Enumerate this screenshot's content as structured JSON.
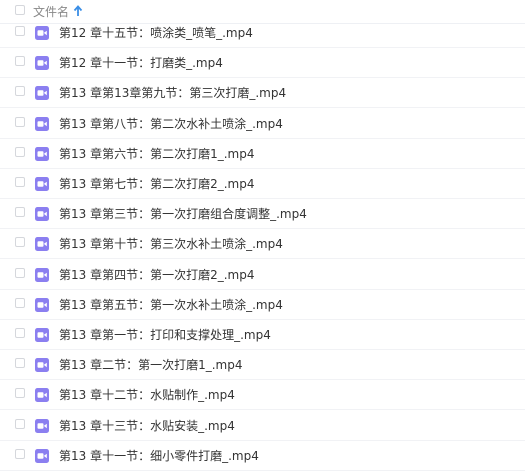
{
  "header": {
    "column_label": "文件名",
    "sort_icon": "sort-ascending-arrow-icon",
    "sort_color": "#3a8ee6"
  },
  "file_icon": "video-file-icon",
  "file_icon_color": "#8b7ff0",
  "files": [
    "第12 章十五节：喷涂类_喷笔_.mp4",
    "第12 章十一节：打磨类_.mp4",
    "第13 章第13章第九节：第三次打磨_.mp4",
    "第13 章第八节：第二次水补土喷涂_.mp4",
    "第13 章第六节：第二次打磨1_.mp4",
    "第13 章第七节：第二次打磨2_.mp4",
    "第13 章第三节：第一次打磨组合度调整_.mp4",
    "第13 章第十节：第三次水补土喷涂_.mp4",
    "第13 章第四节：第一次打磨2_.mp4",
    "第13 章第五节：第一次水补土喷涂_.mp4",
    "第13 章第一节：打印和支撑处理_.mp4",
    "第13 章二节：第一次打磨1_.mp4",
    "第13 章十二节：水贴制作_.mp4",
    "第13 章十三节：水贴安装_.mp4",
    "第13 章十一节：细小零件打磨_.mp4"
  ]
}
